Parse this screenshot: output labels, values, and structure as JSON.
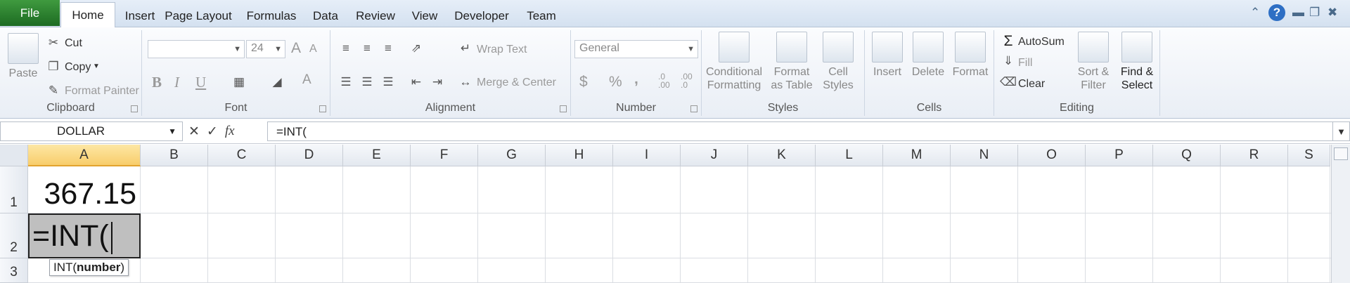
{
  "tabs": {
    "file": "File",
    "items": [
      "Home",
      "Insert",
      "Page Layout",
      "Formulas",
      "Data",
      "Review",
      "View",
      "Developer",
      "Team"
    ],
    "active": "Home"
  },
  "ribbon": {
    "clipboard": {
      "label": "Clipboard",
      "paste": "Paste",
      "cut": "Cut",
      "copy": "Copy",
      "format_painter": "Format Painter"
    },
    "font": {
      "label": "Font",
      "font_name": "",
      "font_size": "24",
      "bold": "B",
      "italic": "I",
      "underline": "U",
      "grow": "A",
      "shrink": "A"
    },
    "alignment": {
      "label": "Alignment",
      "wrap_text": "Wrap Text",
      "merge_center": "Merge & Center"
    },
    "number": {
      "label": "Number",
      "format": "General",
      "currency": "$",
      "percent": "%",
      "comma": ",",
      "inc_decimal": ".0\n.00",
      "dec_decimal": ".00\n.0"
    },
    "styles": {
      "label": "Styles",
      "conditional": "Conditional\nFormatting",
      "format_table": "Format\nas Table",
      "cell_styles": "Cell\nStyles"
    },
    "cells": {
      "label": "Cells",
      "insert": "Insert",
      "delete": "Delete",
      "format": "Format"
    },
    "editing": {
      "label": "Editing",
      "autosum": "AutoSum",
      "fill": "Fill",
      "clear": "Clear",
      "sort_filter": "Sort &\nFilter",
      "find_select": "Find &\nSelect"
    }
  },
  "formula_bar": {
    "name_box": "DOLLAR",
    "fx": "fx",
    "formula": "=INT("
  },
  "grid": {
    "columns": [
      "A",
      "B",
      "C",
      "D",
      "E",
      "F",
      "G",
      "H",
      "I",
      "J",
      "K",
      "L",
      "M",
      "N",
      "O",
      "P",
      "Q",
      "R",
      "S"
    ],
    "selected_column": "A",
    "rows": [
      "1",
      "2",
      "3"
    ],
    "cells": {
      "A1": "367.15",
      "A2": "=INT("
    },
    "tooltip": {
      "func": "INT(",
      "arg": "number",
      "close": ")"
    }
  }
}
